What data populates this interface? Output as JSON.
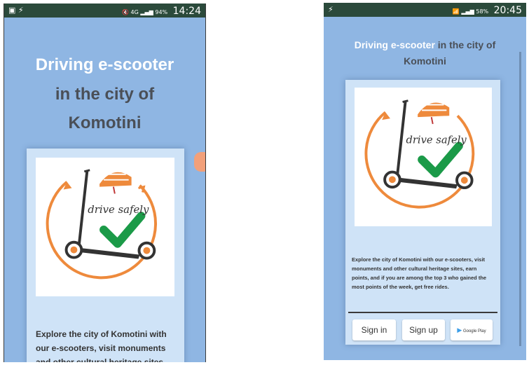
{
  "left": {
    "status": {
      "left_icons": "▣ ⚡",
      "right_icons": "🔇 4G ▂▄▆ 94%",
      "time": "14:24"
    },
    "title_line1": "Driving e-scooter",
    "title_line2": "in the city of",
    "title_line3": "Komotini",
    "logo_text": "drive safely",
    "description": "Explore the city of Komotini with our e-scooters, visit monuments and other cultural heritage sites"
  },
  "right": {
    "status": {
      "left_icons": "⚡",
      "right_icons": "📶 ▂▄▆ 58%",
      "time": "20:45"
    },
    "title_highlight": "Driving e-scooter",
    "title_rest": " in the city of",
    "title_line2": "Komotini",
    "logo_text": "drive safely",
    "description": "Explore the city of Komotini with our e-scooters, visit monuments and other cultural heritage sites, earn points, and if you are among the top 3 who gained the most points of the week, get free rides.",
    "buttons": {
      "sign_in": "Sign in",
      "sign_up": "Sign up",
      "google_play": "Google Play"
    }
  },
  "colors": {
    "background": "#8fb6e3",
    "card": "#cfe3f7",
    "statusbar": "#2b4a3b",
    "accent_orange": "#ee8a3c",
    "check_green": "#1b9a48"
  }
}
